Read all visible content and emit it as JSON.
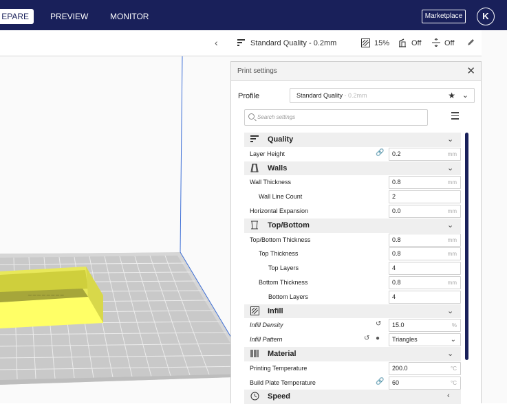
{
  "stages": {
    "prepare": "EPARE",
    "preview": "PREVIEW",
    "monitor": "MONITOR"
  },
  "header": {
    "marketplace_label": "Marketplace",
    "account_initial": "K"
  },
  "print_bar": {
    "profile": "Standard Quality - 0.2mm",
    "infill": "15%",
    "support": "Off",
    "adhesion": "Off"
  },
  "panel": {
    "title": "Print settings",
    "profile_label": "Profile",
    "profile_value": "Standard Quality",
    "profile_suffix": " - 0.2mm",
    "search_placeholder": "Search settings"
  },
  "settings": {
    "quality": "Quality",
    "layer_height": {
      "label": "Layer Height",
      "value": "0.2",
      "unit": "mm"
    },
    "walls": "Walls",
    "wall_thickness": {
      "label": "Wall Thickness",
      "value": "0.8",
      "unit": "mm"
    },
    "wall_line_count": {
      "label": "Wall Line Count",
      "value": "2"
    },
    "horizontal_expansion": {
      "label": "Horizontal Expansion",
      "value": "0.0",
      "unit": "mm"
    },
    "top_bottom": "Top/Bottom",
    "top_bottom_thickness": {
      "label": "Top/Bottom Thickness",
      "value": "0.8",
      "unit": "mm"
    },
    "top_thickness": {
      "label": "Top Thickness",
      "value": "0.8",
      "unit": "mm"
    },
    "top_layers": {
      "label": "Top Layers",
      "value": "4"
    },
    "bottom_thickness": {
      "label": "Bottom Thickness",
      "value": "0.8",
      "unit": "mm"
    },
    "bottom_layers": {
      "label": "Bottom Layers",
      "value": "4"
    },
    "infill": "Infill",
    "infill_density": {
      "label": "Infill Density",
      "value": "15.0",
      "unit": "%"
    },
    "infill_pattern": {
      "label": "Infill Pattern",
      "value": "Triangles"
    },
    "material": "Material",
    "printing_temperature": {
      "label": "Printing Temperature",
      "value": "200.0",
      "unit": "°C"
    },
    "build_plate_temperature": {
      "label": "Build Plate Temperature",
      "value": "60",
      "unit": "°C"
    },
    "speed": "Speed"
  },
  "colors": {
    "header_bg": "#19205a",
    "model_yellow": "#ffff66",
    "build_plate": "#d4d4d4"
  }
}
